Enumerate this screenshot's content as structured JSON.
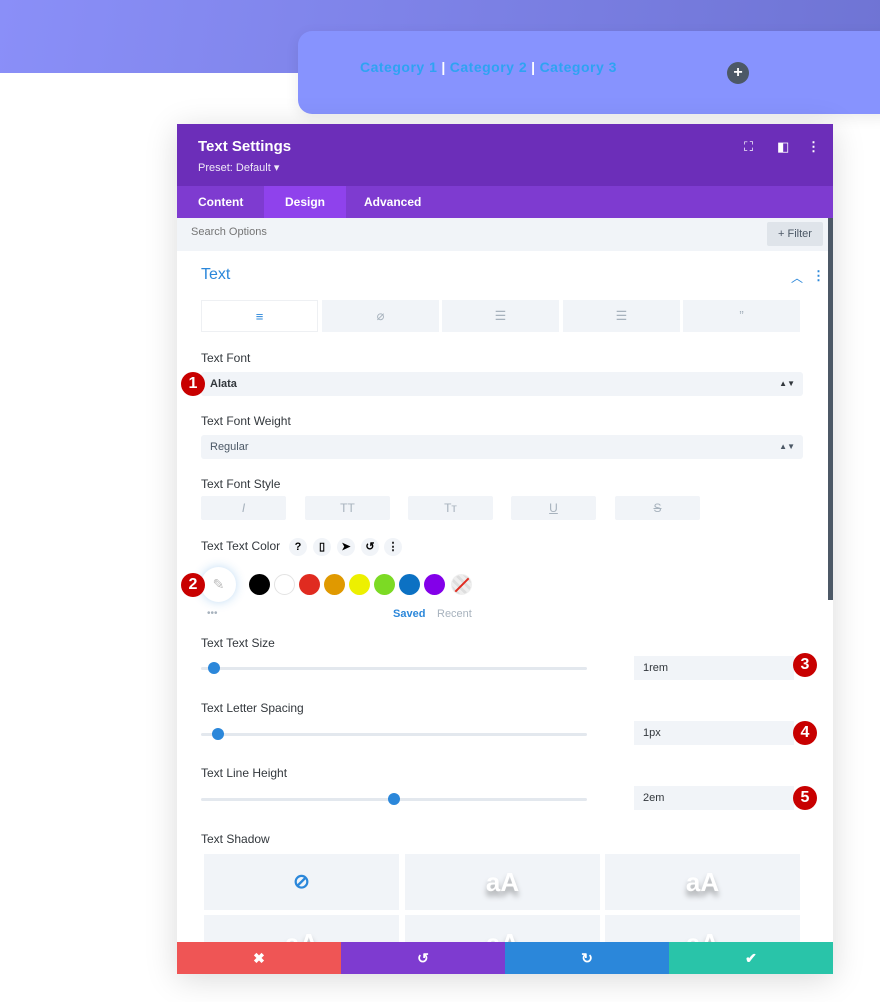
{
  "canvas": {
    "categories": [
      "Category 1",
      "Category 2",
      "Category 3"
    ],
    "separator": "|",
    "add_icon": "plus-icon"
  },
  "panel": {
    "title": "Text Settings",
    "preset": "Preset: Default ▾",
    "tabs": [
      {
        "label": "Content"
      },
      {
        "label": "Design",
        "active": true
      },
      {
        "label": "Advanced"
      }
    ],
    "search_placeholder": "Search Options",
    "filter_label": "+ Filter",
    "section_title": "Text",
    "subtabs": [
      "align-left-icon",
      "link-icon",
      "unordered-list-icon",
      "ordered-list-icon",
      "quote-icon"
    ],
    "font": {
      "label": "Text Font",
      "value": "Alata"
    },
    "weight": {
      "label": "Text Font Weight",
      "value": "Regular"
    },
    "style": {
      "label": "Text Font Style",
      "options": [
        "I",
        "TT",
        "Tт",
        "U",
        "S"
      ]
    },
    "color": {
      "label": "Text Text Color",
      "swatches": [
        "#000000",
        "#ffffff",
        "#e02b20",
        "#e09900",
        "#edf000",
        "#7cda24",
        "#0c71c3",
        "#8300e9"
      ],
      "saved": "Saved",
      "recent": "Recent",
      "more": "•••"
    },
    "size": {
      "label": "Text Text Size",
      "value": "1rem",
      "slider_percent": 2
    },
    "spacing": {
      "label": "Text Letter Spacing",
      "value": "1px",
      "slider_percent": 3
    },
    "line_height": {
      "label": "Text Line Height",
      "value": "2em",
      "slider_percent": 50
    },
    "shadow": {
      "label": "Text Shadow",
      "preview": "aA"
    },
    "badges": [
      "1",
      "2",
      "3",
      "4",
      "5"
    ],
    "footer": {
      "colors": [
        "#ef5555",
        "#7e3bd0",
        "#2b87da",
        "#29c4a9"
      ]
    }
  }
}
